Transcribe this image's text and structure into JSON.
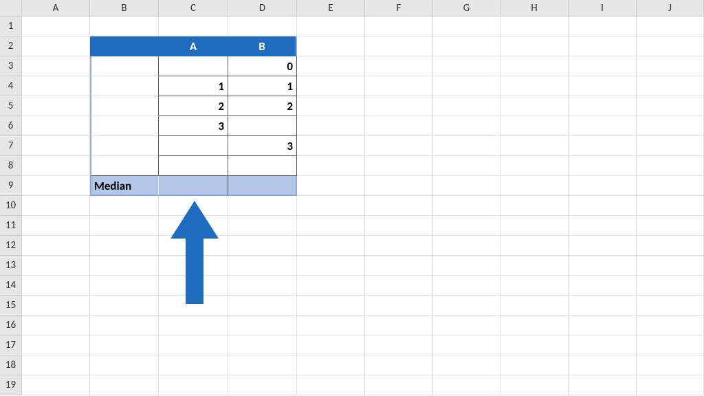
{
  "columns": [
    "A",
    "B",
    "C",
    "D",
    "E",
    "F",
    "G",
    "H",
    "I",
    "J"
  ],
  "rows": [
    "1",
    "2",
    "3",
    "4",
    "5",
    "6",
    "7",
    "8",
    "9",
    "10",
    "11",
    "12",
    "13",
    "14",
    "15",
    "16",
    "17",
    "18",
    "19"
  ],
  "table": {
    "header": {
      "b": "",
      "c": "A",
      "d": "B"
    },
    "data_rows": [
      {
        "c": "",
        "d": "0"
      },
      {
        "c": "1",
        "d": "1"
      },
      {
        "c": "2",
        "d": "2"
      },
      {
        "c": "3",
        "d": ""
      },
      {
        "c": "",
        "d": "3"
      },
      {
        "c": "",
        "d": ""
      }
    ],
    "median": {
      "label": "Median",
      "c": "",
      "d": ""
    }
  },
  "chart_data": {
    "type": "table",
    "title": "",
    "columns": [
      "A",
      "B"
    ],
    "rows": [
      {
        "A": null,
        "B": 0
      },
      {
        "A": 1,
        "B": 1
      },
      {
        "A": 2,
        "B": 2
      },
      {
        "A": 3,
        "B": null
      },
      {
        "A": null,
        "B": 3
      },
      {
        "A": null,
        "B": null
      }
    ],
    "footer": {
      "label": "Median",
      "A": null,
      "B": null
    }
  },
  "arrow_color": "#1f6cbf"
}
